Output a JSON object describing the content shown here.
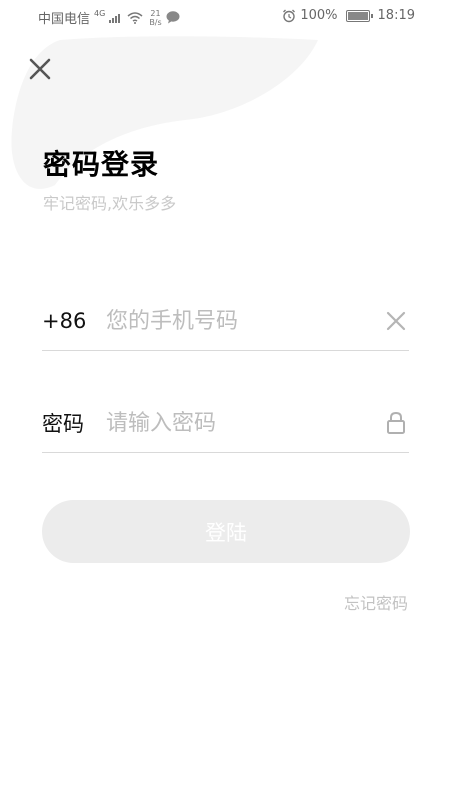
{
  "status_bar": {
    "carrier": "中国电信",
    "signal_type": "4G",
    "net_speed_value": "21",
    "net_speed_unit": "B/s",
    "battery": "100%",
    "time": "18:19"
  },
  "header": {
    "title": "密码登录",
    "subtitle": "牢记密码,欢乐多多"
  },
  "phone_field": {
    "prefix": "+86",
    "value": "",
    "placeholder": "您的手机号码"
  },
  "password_field": {
    "label": "密码",
    "value": "",
    "placeholder": "请输入密码"
  },
  "login_button": {
    "label": "登陆"
  },
  "forgot_password": {
    "label": "忘记密码"
  },
  "colors": {
    "background": "#ffffff",
    "blob": "#f5f5f5",
    "title": "#000000",
    "subtitle": "#c9c9c9",
    "placeholder": "#bdbdbd",
    "divider": "#d9d9d9",
    "button_bg": "#ececec",
    "button_text": "#ffffff",
    "link": "#c2c2c2"
  },
  "icons": {
    "close": "close-icon",
    "clear": "clear-icon",
    "lock": "lock-icon"
  }
}
